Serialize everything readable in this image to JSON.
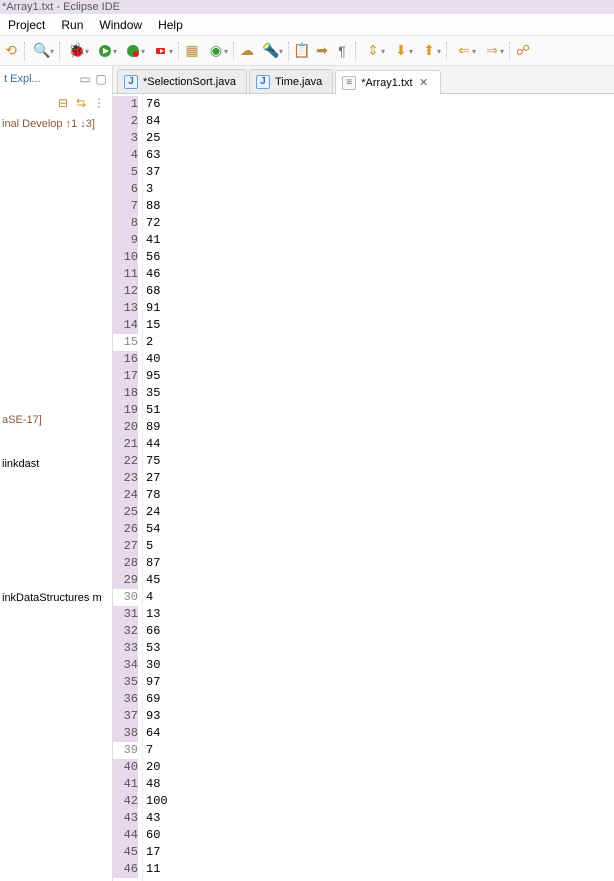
{
  "window": {
    "title": "*Array1.txt - Eclipse IDE"
  },
  "menubar": {
    "items": [
      "Project",
      "Run",
      "Window",
      "Help"
    ]
  },
  "sidebar": {
    "view_title": "t Expl...",
    "items": [
      {
        "label": "inal Develop ↑1 ↓3]",
        "cls": "tree-brown"
      },
      {
        "label": "aSE-17]",
        "cls": "tree-brown",
        "gap_before": "gap-lg"
      },
      {
        "label": "iinkdast",
        "cls": "tree-black",
        "gap_before": "gap-md"
      },
      {
        "label": "inkDataStructures m",
        "cls": "tree-black",
        "gap_before": "gap-xl"
      }
    ]
  },
  "tabs": [
    {
      "label": "*SelectionSort.java",
      "icon": "J",
      "iconType": "java",
      "active": false,
      "closable": false
    },
    {
      "label": "Time.java",
      "icon": "J",
      "iconType": "java",
      "active": false,
      "closable": false
    },
    {
      "label": "*Array1.txt",
      "icon": "≡",
      "iconType": "txt",
      "active": true,
      "closable": true
    }
  ],
  "editor": {
    "highlight_lines": [
      1,
      2,
      3,
      4,
      5,
      6,
      7,
      8,
      9,
      10,
      11,
      12,
      13,
      14,
      16,
      17,
      18,
      19,
      20,
      21,
      22,
      23,
      24,
      25,
      26,
      27,
      28,
      29,
      31,
      32,
      33,
      34,
      35,
      36,
      37,
      38,
      40,
      41,
      42,
      43,
      44,
      45,
      46
    ],
    "lines": [
      "76",
      "84",
      "25",
      "63",
      "37",
      "3",
      "88",
      "72",
      "41",
      "56",
      "46",
      "68",
      "91",
      "15",
      "2",
      "40",
      "95",
      "35",
      "51",
      "89",
      "44",
      "75",
      "27",
      "78",
      "24",
      "54",
      "5",
      "87",
      "45",
      "4",
      "13",
      "66",
      "53",
      "30",
      "97",
      "69",
      "93",
      "64",
      "7",
      "20",
      "48",
      "100",
      "43",
      "60",
      "17",
      "11"
    ]
  }
}
